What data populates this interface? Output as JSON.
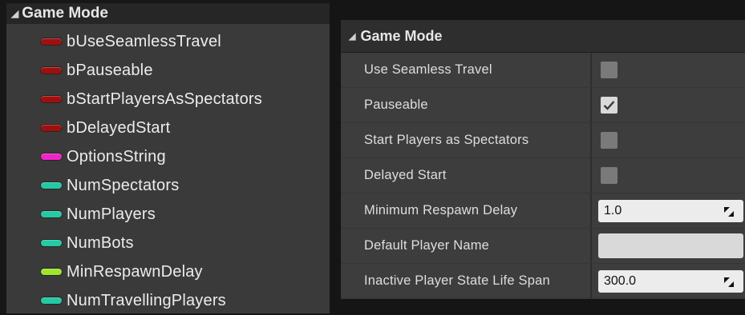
{
  "left_panel": {
    "title": "Game Mode",
    "variables": [
      {
        "name": "bUseSeamlessTravel",
        "color": "#a00f0f"
      },
      {
        "name": "bPauseable",
        "color": "#a00f0f"
      },
      {
        "name": "bStartPlayersAsSpectators",
        "color": "#a00f0f"
      },
      {
        "name": "bDelayedStart",
        "color": "#a00f0f"
      },
      {
        "name": "OptionsString",
        "color": "#f024c8"
      },
      {
        "name": "NumSpectators",
        "color": "#25c9a3"
      },
      {
        "name": "NumPlayers",
        "color": "#25c9a3"
      },
      {
        "name": "NumBots",
        "color": "#25c9a3"
      },
      {
        "name": "MinRespawnDelay",
        "color": "#9fe52b"
      },
      {
        "name": "NumTravellingPlayers",
        "color": "#25c9a3"
      }
    ]
  },
  "details_panel": {
    "title": "Game Mode",
    "rows": [
      {
        "label": "Use Seamless Travel",
        "type": "checkbox",
        "checked": false
      },
      {
        "label": "Pauseable",
        "type": "checkbox",
        "checked": true
      },
      {
        "label": "Start Players as Spectators",
        "type": "checkbox",
        "checked": false
      },
      {
        "label": "Delayed Start",
        "type": "checkbox",
        "checked": false
      },
      {
        "label": "Minimum Respawn Delay",
        "type": "number",
        "value": "1.0"
      },
      {
        "label": "Default Player Name",
        "type": "text",
        "value": ""
      },
      {
        "label": "Inactive Player State Life Span",
        "type": "number",
        "value": "300.0"
      }
    ]
  },
  "icons": {
    "collapse": "collapse-triangle-icon",
    "checkmark": "checkmark-icon",
    "spin": "numeric-drag-icon"
  }
}
